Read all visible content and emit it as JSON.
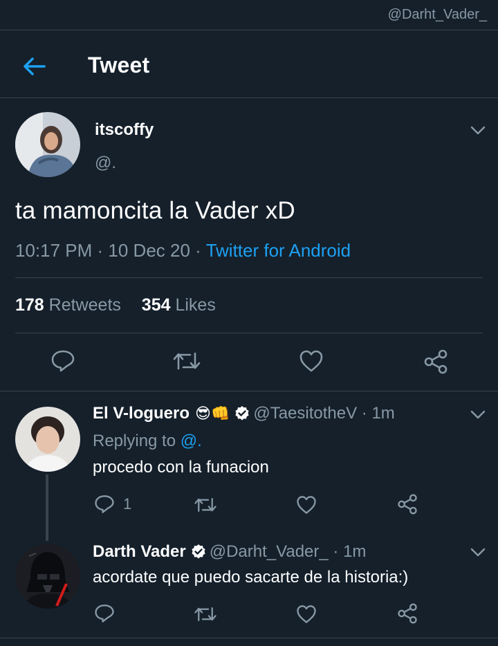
{
  "watermark": "@Darht_Vader_",
  "header": {
    "title": "Tweet"
  },
  "tweet": {
    "display_name": "itscoffy",
    "handle": "@.",
    "text": "ta mamoncita la Vader xD",
    "time": "10:17 PM",
    "date": "10 Dec 20",
    "source": "Twitter for Android",
    "retweets_count": "178",
    "retweets_label": "Retweets",
    "likes_count": "354",
    "likes_label": "Likes"
  },
  "replies": [
    {
      "display_name": "El V-loguero",
      "emoji": "😎👊",
      "handle": "@TaesitotheV",
      "time": "1m",
      "replying_prefix": "Replying to",
      "replying_handle": "@.",
      "text": "procedo con la funacion",
      "reply_count": "1"
    },
    {
      "display_name": "Darth Vader",
      "handle": "@Darht_Vader_",
      "time": "1m",
      "text": "acordate que puedo sacarte de la historia:)"
    }
  ],
  "colors": {
    "background": "#15202b",
    "accent": "#1da1f2",
    "muted": "#8899a6",
    "divider": "#38444d"
  },
  "icons": [
    "back-arrow-icon",
    "chevron-down-icon",
    "reply-icon",
    "retweet-icon",
    "like-icon",
    "share-icon",
    "verified-badge-icon"
  ]
}
